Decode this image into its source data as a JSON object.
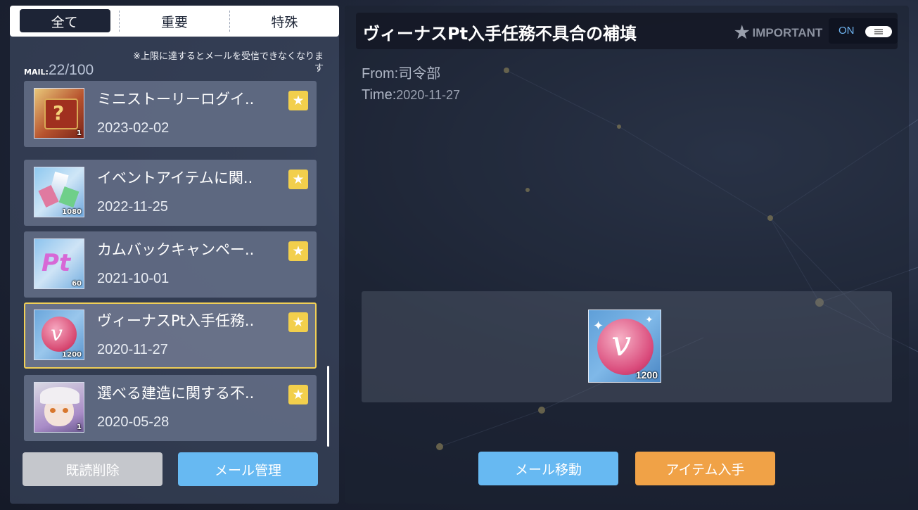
{
  "tabs": [
    {
      "label": "全て",
      "active": true
    },
    {
      "label": "重要",
      "active": false
    },
    {
      "label": "特殊",
      "active": false
    }
  ],
  "mail_count": {
    "label": "MAIL:",
    "current": "22",
    "max": "/100"
  },
  "mail_note": "※上限に達するとメールを受信できなくなります",
  "mails": [
    {
      "subject": "ミニストーリーログイ..",
      "date": "2023-02-02",
      "qty": "1",
      "icon": "mystery-box-icon",
      "selected": false
    },
    {
      "subject": "イベントアイテムに関..",
      "date": "2022-11-25",
      "qty": "1080",
      "icon": "crystal-icon",
      "selected": false
    },
    {
      "subject": "カムバックキャンペー..",
      "date": "2021-10-01",
      "qty": "60",
      "icon": "pt-icon",
      "selected": false
    },
    {
      "subject": "ヴィーナスPt入手任務..",
      "date": "2020-11-27",
      "qty": "1200",
      "icon": "venus-coin-icon",
      "selected": true
    },
    {
      "subject": "選べる建造に関する不..",
      "date": "2020-05-28",
      "qty": "1",
      "icon": "character-portrait-icon",
      "selected": false
    }
  ],
  "buttons": {
    "delete_read": "既読削除",
    "manage": "メール管理",
    "move": "メール移動",
    "get_item": "アイテム入手"
  },
  "detail": {
    "title": "ヴィーナスPt入手任務不具合の補填",
    "important_label": "IMPORTANT",
    "toggle_label": "ON",
    "from_label": "From:",
    "from_value": "司令部",
    "time_label": "Time:",
    "time_value": "2020-11-27",
    "reward_qty": "1200"
  },
  "colors": {
    "accent_yellow": "#f0cf57",
    "button_blue": "#67b9f2",
    "button_orange": "#f0a247",
    "button_gray": "#c5c7cc"
  }
}
